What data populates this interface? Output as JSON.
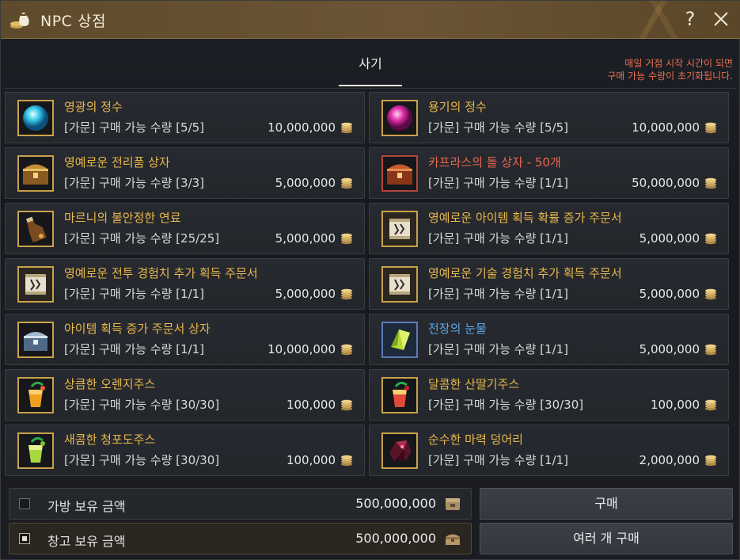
{
  "window": {
    "title": "NPC 상점"
  },
  "tabs": [
    {
      "label": "사기"
    }
  ],
  "notice": {
    "line1": "매일 거점 시작 시간이 되면",
    "line2": "구매 가능 수량이 초기화됩니다."
  },
  "colors": {
    "gold": "#e9b84a",
    "red": "#ea6552",
    "blue": "#5aa9e8"
  },
  "items": [
    {
      "name": "영광의 정수",
      "limit": "[가문] 구매 가능 수량 [5/5]",
      "price": "10,000,000",
      "name_color": "gold",
      "icon": "cyan-orb-icon"
    },
    {
      "name": "용기의 정수",
      "limit": "[가문] 구매 가능 수량 [5/5]",
      "price": "10,000,000",
      "name_color": "gold",
      "icon": "magenta-orb-icon"
    },
    {
      "name": "영예로운 전리품 상자",
      "limit": "[가문] 구매 가능 수량 [3/3]",
      "price": "5,000,000",
      "name_color": "gold",
      "icon": "gold-chest-icon"
    },
    {
      "name": "카프라스의 돌 상자 - 50개",
      "limit": "[가문] 구매 가능 수량 [1/1]",
      "price": "50,000,000",
      "name_color": "red",
      "icon": "red-chest-icon"
    },
    {
      "name": "마르니의 불안정한 연료",
      "limit": "[가문] 구매 가능 수량 [25/25]",
      "price": "5,000,000",
      "name_color": "gold",
      "icon": "fuel-flask-icon"
    },
    {
      "name": "영예로운 아이템 획득 확률 증가 주문서",
      "limit": "[가문] 구매 가능 수량 [1/1]",
      "price": "5,000,000",
      "name_color": "gold",
      "icon": "scroll-icon"
    },
    {
      "name": "영예로운 전투 경험치 추가 획득 주문서",
      "limit": "[가문] 구매 가능 수량 [1/1]",
      "price": "5,000,000",
      "name_color": "gold",
      "icon": "scroll-icon"
    },
    {
      "name": "영예로운 기술 경험치 추가 획득 주문서",
      "limit": "[가문] 구매 가능 수량 [1/1]",
      "price": "5,000,000",
      "name_color": "gold",
      "icon": "scroll-icon"
    },
    {
      "name": "아이템 획득 증가 주문서 상자",
      "limit": "[가문] 구매 가능 수량 [1/1]",
      "price": "10,000,000",
      "name_color": "gold",
      "icon": "blue-chest-icon"
    },
    {
      "name": "전장의 눈물",
      "limit": "[가문] 구매 가능 수량 [1/1]",
      "price": "5,000,000",
      "name_color": "blue",
      "icon": "green-crystal-icon"
    },
    {
      "name": "상큼한 오렌지주스",
      "limit": "[가문] 구매 가능 수량 [30/30]",
      "price": "100,000",
      "name_color": "gold",
      "icon": "orange-juice-icon"
    },
    {
      "name": "달콤한 산딸기주스",
      "limit": "[가문] 구매 가능 수량 [30/30]",
      "price": "100,000",
      "name_color": "gold",
      "icon": "berry-juice-icon"
    },
    {
      "name": "새콤한 청포도주스",
      "limit": "[가문] 구매 가능 수량 [30/30]",
      "price": "100,000",
      "name_color": "gold",
      "icon": "grape-juice-icon"
    },
    {
      "name": "순수한 마력 덩어리",
      "limit": "[가문] 구매 가능 수량 [1/1]",
      "price": "2,000,000",
      "name_color": "gold",
      "icon": "mana-ore-icon"
    }
  ],
  "bag": {
    "label": "가방 보유 금액",
    "amount": "500,000,000",
    "checked": false
  },
  "storage": {
    "label": "창고 보유 금액",
    "amount": "500,000,000",
    "checked": true
  },
  "buttons": {
    "buy": "구매",
    "buy_multiple": "여러 개 구매"
  }
}
